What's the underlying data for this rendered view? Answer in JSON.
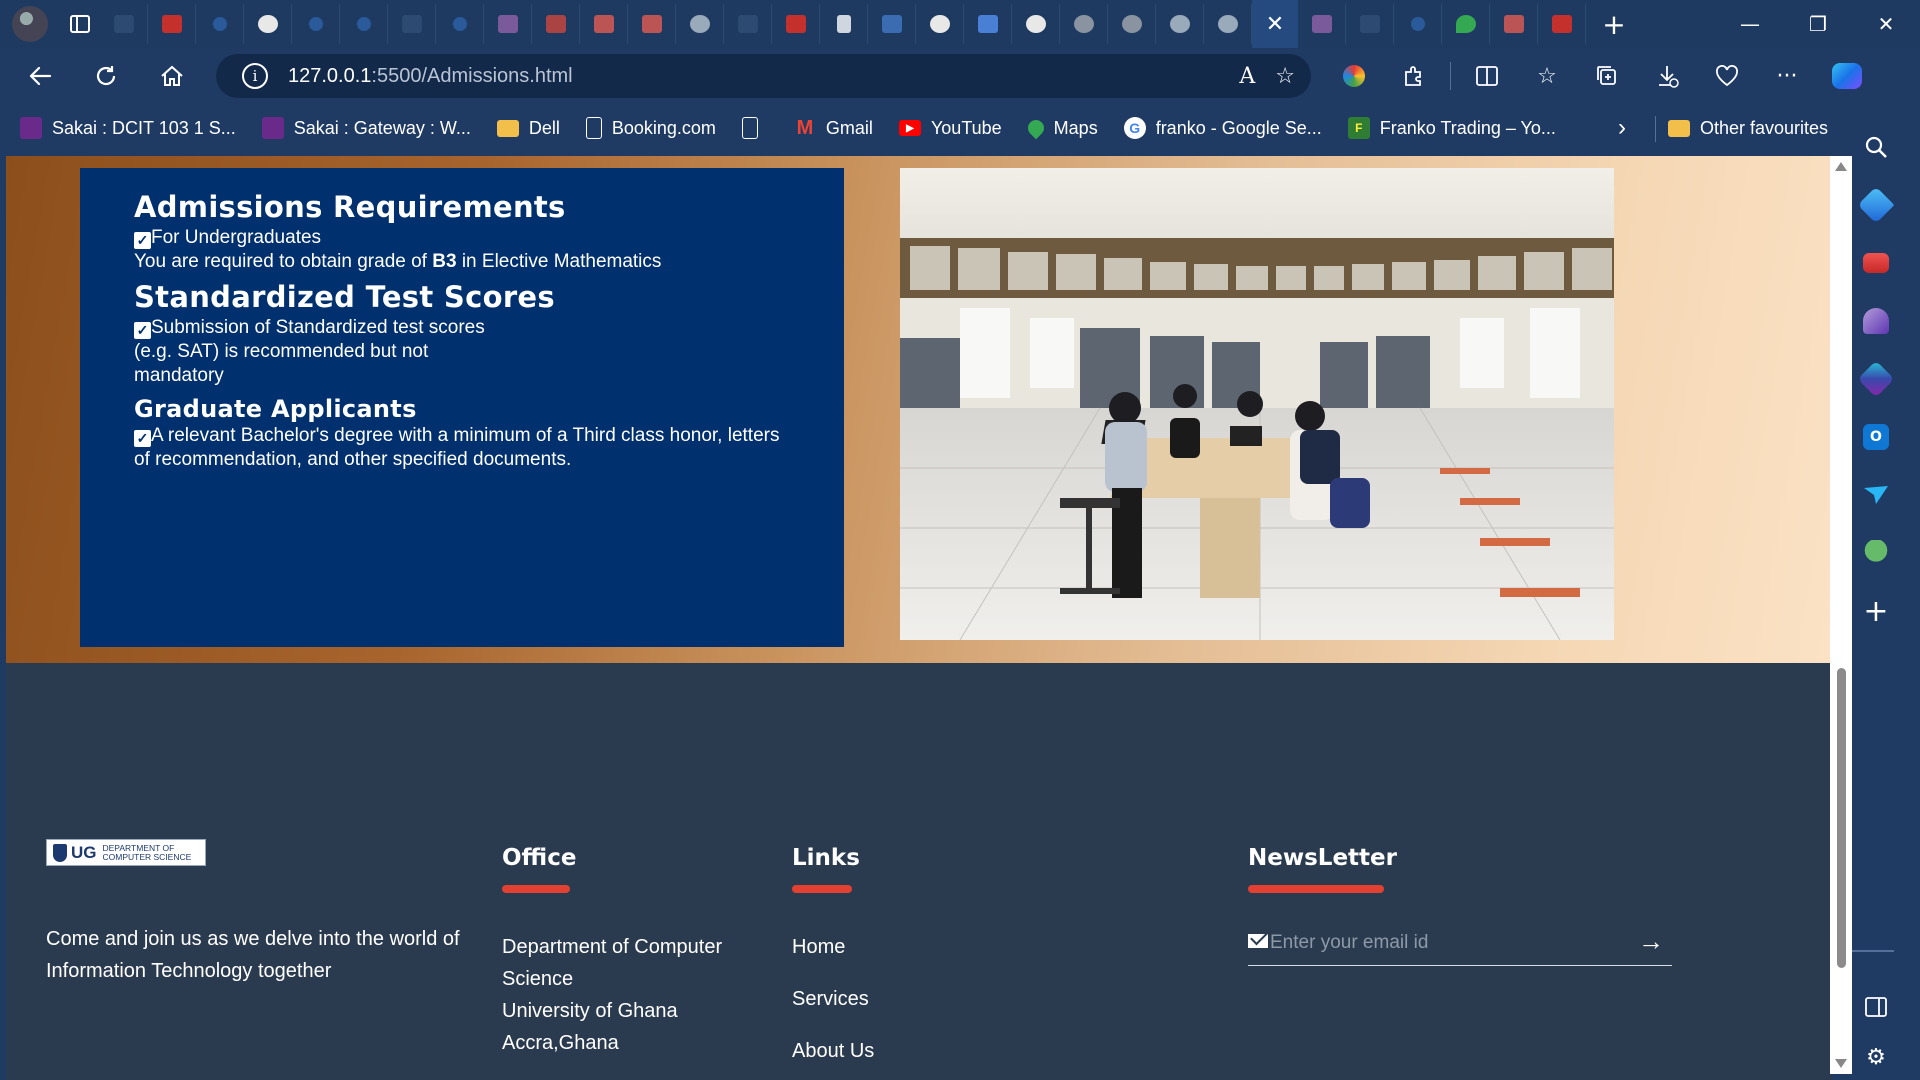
{
  "browser": {
    "url_host": "127.0.0.1",
    "url_path": ":5500/Admissions.html",
    "read_aloud_label": "A",
    "bookmarks": [
      {
        "label": "Sakai : DCIT 103 1 S...",
        "icon": "sakai-icon",
        "color": "#6a2a8a"
      },
      {
        "label": "Sakai : Gateway : W...",
        "icon": "sakai-icon",
        "color": "#6a2a8a"
      },
      {
        "label": "Dell",
        "icon": "folder-icon",
        "color": "#f2c04a"
      },
      {
        "label": "Booking.com",
        "icon": "page-icon",
        "color": "#ffffff"
      },
      {
        "label": "",
        "icon": "page-icon",
        "color": "#ffffff"
      },
      {
        "label": "Gmail",
        "icon": "gmail-icon",
        "color": "#ea4335"
      },
      {
        "label": "YouTube",
        "icon": "youtube-icon",
        "color": "#ff0000"
      },
      {
        "label": "Maps",
        "icon": "maps-icon",
        "color": "#34a853"
      },
      {
        "label": "franko - Google Se...",
        "icon": "google-icon",
        "color": "#4285f4"
      },
      {
        "label": "Franko Trading – Yo...",
        "icon": "franko-icon",
        "color": "#2e7d32"
      }
    ],
    "other_favourites": "Other favourites"
  },
  "admissions": {
    "title": "Admissions Requirements",
    "undergrad_label": "For Undergraduates",
    "undergrad_text_pre": "You are required to obtain grade of ",
    "undergrad_grade": "B3",
    "undergrad_text_post": " in Elective Mathematics",
    "sat_title": "Standardized Test Scores",
    "sat_text": "Submission of Standardized test scores (e.g. SAT) is recommended but not mandatory",
    "grad_title": "Graduate Applicants",
    "grad_text": "A relevant Bachelor's degree with a minimum of a Third class honor, letters of recommendation, and other specified documents."
  },
  "footer": {
    "logo_mark": "UG",
    "logo_dept_line1": "DEPARTMENT OF",
    "logo_dept_line2": "COMPUTER SCIENCE",
    "tagline": "Come and join us as we delve into the world of Information Technology together",
    "office_title": "Office",
    "office_lines": [
      "Department of Computer Science",
      "University of Ghana",
      "Accra,Ghana"
    ],
    "links_title": "Links",
    "links": [
      "Home",
      "Services",
      "About Us"
    ],
    "newsletter_title": "NewsLetter",
    "newsletter_placeholder": "Enter your email id",
    "accent_color": "#e24131"
  },
  "colors": {
    "card_bg": "#00306d",
    "footer_bg": "#2b3b4f",
    "browser_chrome": "#1f3b63"
  }
}
